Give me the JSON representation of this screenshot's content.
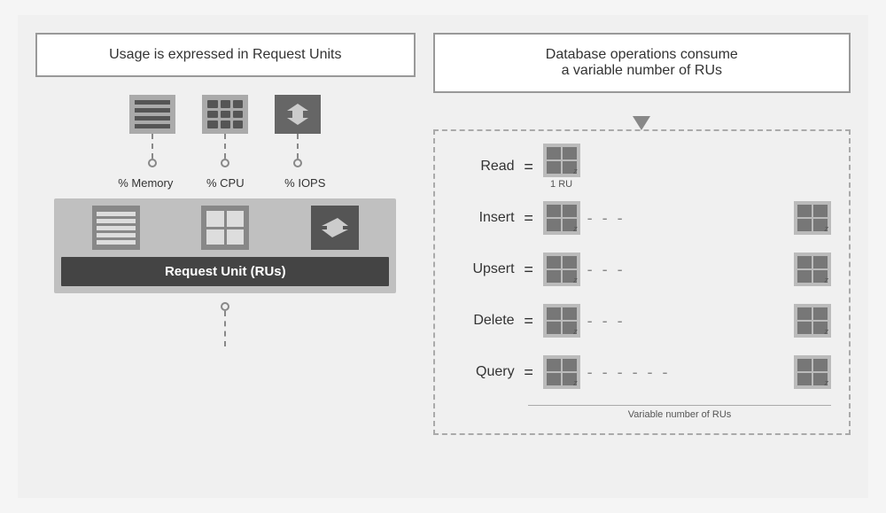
{
  "left": {
    "title": "Usage is expressed in Request Units",
    "icons": [
      {
        "label": "% Memory",
        "type": "memory"
      },
      {
        "label": "% CPU",
        "type": "cpu"
      },
      {
        "label": "% IOPS",
        "type": "iops"
      }
    ],
    "ru_label": "Request Unit (RUs)"
  },
  "right": {
    "title": "Database operations consume\na variable number of RUs",
    "ops": [
      {
        "label": "Read",
        "dashes": "",
        "ru_count": 1,
        "show_second": false,
        "sub": "1 RU"
      },
      {
        "label": "Insert",
        "dashes": "- - -",
        "ru_count": 1,
        "show_second": true
      },
      {
        "label": "Upsert",
        "dashes": "- - -",
        "ru_count": 1,
        "show_second": true
      },
      {
        "label": "Delete",
        "dashes": "- - -",
        "ru_count": 1,
        "show_second": true
      },
      {
        "label": "Query",
        "dashes": "- - - - - -",
        "ru_count": 1,
        "show_second": true
      }
    ],
    "variable_label": "Variable number of RUs"
  }
}
